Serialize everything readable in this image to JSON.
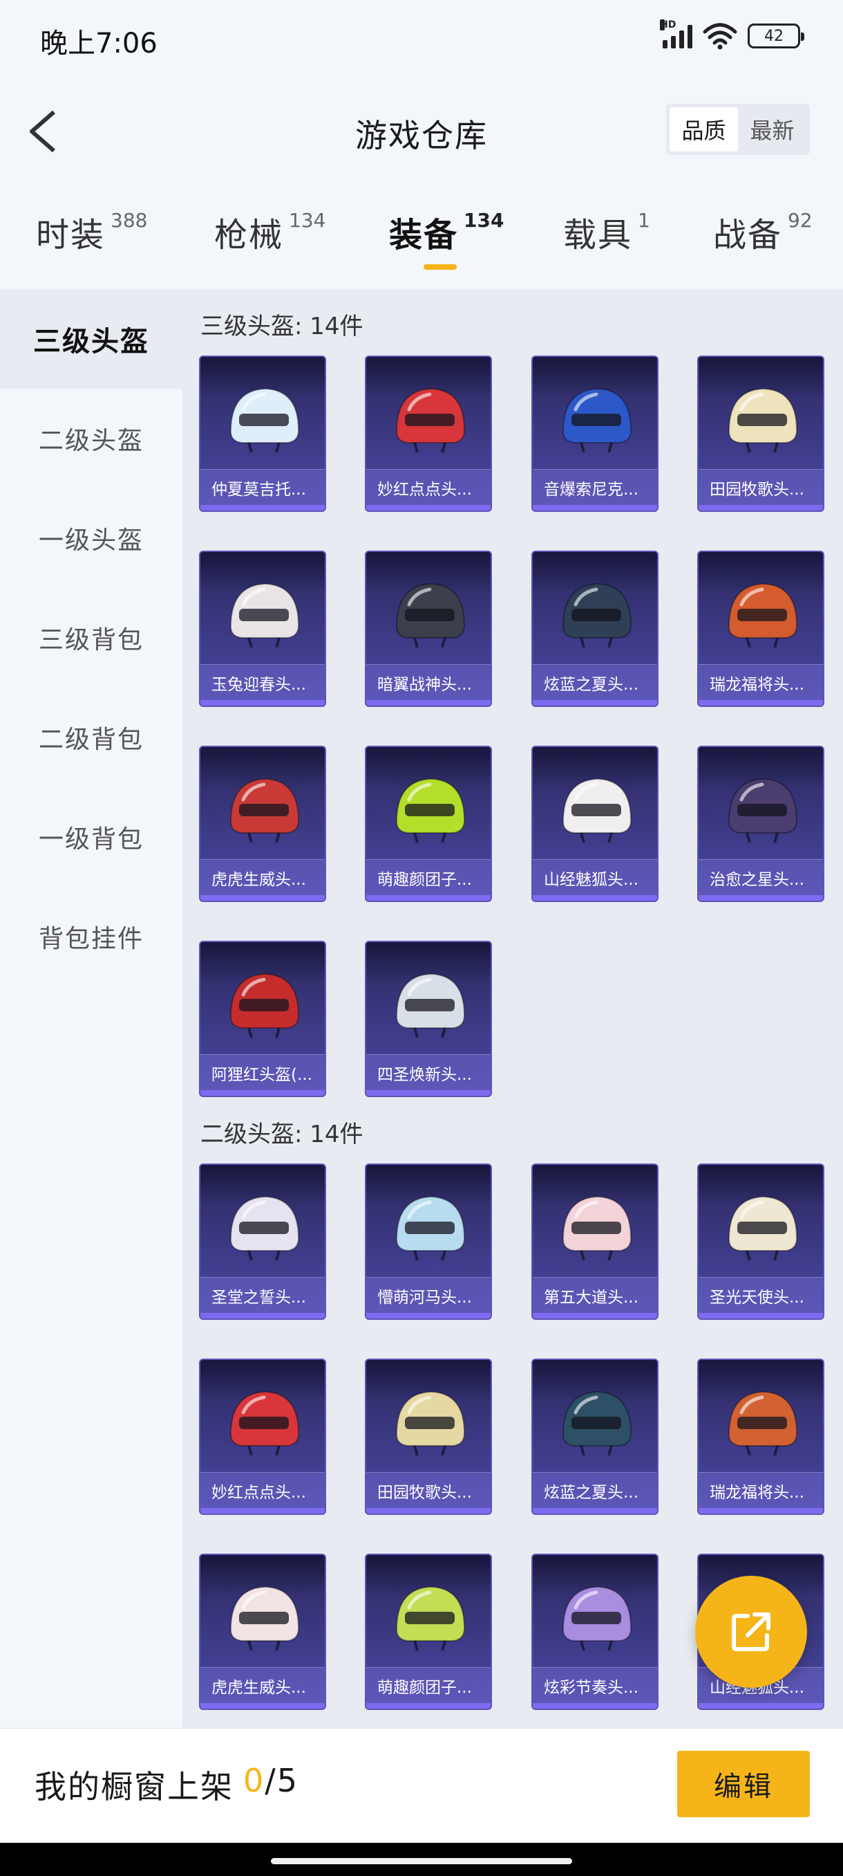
{
  "status_bar": {
    "time": "晚上7:06",
    "network": "HD",
    "battery": "42"
  },
  "header": {
    "title": "游戏仓库",
    "sort_options": [
      "品质",
      "最新"
    ],
    "sort_active": "品质"
  },
  "tabs": [
    {
      "label": "时装",
      "count": "388"
    },
    {
      "label": "枪械",
      "count": "134"
    },
    {
      "label": "装备",
      "count": "134"
    },
    {
      "label": "载具",
      "count": "1"
    },
    {
      "label": "战备",
      "count": "92"
    }
  ],
  "active_tab": "装备",
  "sidebar": {
    "items": [
      "三级头盔",
      "二级头盔",
      "一级头盔",
      "三级背包",
      "二级背包",
      "一级背包",
      "背包挂件"
    ],
    "active": "三级头盔"
  },
  "sections": [
    {
      "title": "三级头盔: 14件",
      "items": [
        {
          "name": "仲夏莫吉托...",
          "color": "#dfeefa"
        },
        {
          "name": "妙红点点头...",
          "color": "#d8363a"
        },
        {
          "name": "音爆索尼克...",
          "color": "#2d59c8"
        },
        {
          "name": "田园牧歌头...",
          "color": "#efe3bd"
        },
        {
          "name": "玉兔迎春头...",
          "color": "#e9e4e6"
        },
        {
          "name": "暗翼战神头...",
          "color": "#3c3f4c"
        },
        {
          "name": "炫蓝之夏头...",
          "color": "#2f3f56"
        },
        {
          "name": "瑞龙福将头...",
          "color": "#d55c2e"
        },
        {
          "name": "虎虎生威头...",
          "color": "#c93a36"
        },
        {
          "name": "萌趣颜团子...",
          "color": "#b3df2b"
        },
        {
          "name": "山经魅狐头...",
          "color": "#f1eef0"
        },
        {
          "name": "治愈之星头...",
          "color": "#4b3d6e"
        },
        {
          "name": "阿狸红头盔(...",
          "color": "#c52d2d"
        },
        {
          "name": "四圣焕新头...",
          "color": "#d9dfe7"
        }
      ]
    },
    {
      "title": "二级头盔: 14件",
      "items": [
        {
          "name": "圣堂之誓头...",
          "color": "#e7e2f0"
        },
        {
          "name": "懵萌河马头...",
          "color": "#b7dcef"
        },
        {
          "name": "第五大道头...",
          "color": "#f1d3d8"
        },
        {
          "name": "圣光天使头...",
          "color": "#eee7d2"
        },
        {
          "name": "妙红点点头...",
          "color": "#d8363a"
        },
        {
          "name": "田园牧歌头...",
          "color": "#e6d8a3"
        },
        {
          "name": "炫蓝之夏头...",
          "color": "#2d5066"
        },
        {
          "name": "瑞龙福将头...",
          "color": "#d36232"
        },
        {
          "name": "虎虎生威头...",
          "color": "#f2e4e4"
        },
        {
          "name": "萌趣颜团子...",
          "color": "#c3dd55"
        },
        {
          "name": "炫彩节奏头...",
          "color": "#a98de0"
        },
        {
          "name": "山经魅狐头...",
          "color": "#f1eef0"
        }
      ]
    }
  ],
  "bottom_bar": {
    "shelf_label": "我的橱窗上架",
    "shelf_count": "0",
    "shelf_total": "/5",
    "edit_label": "编辑"
  }
}
